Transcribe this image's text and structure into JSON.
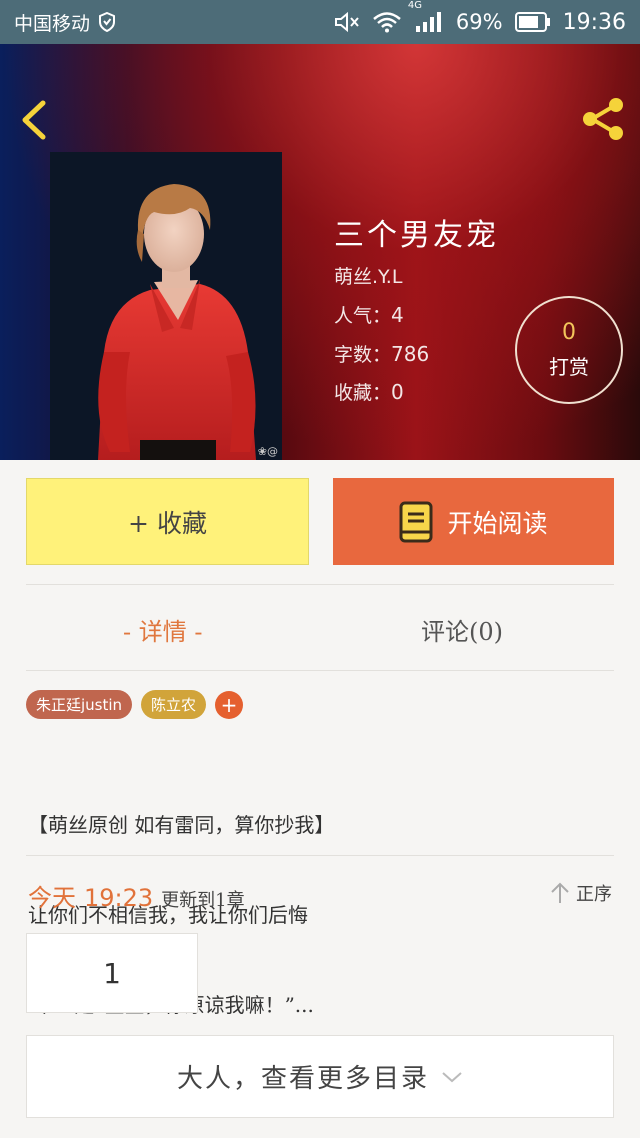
{
  "status_bar": {
    "carrier": "中国移动",
    "network": "4G",
    "battery": "69%",
    "time": "19:36"
  },
  "book": {
    "title": "三个男友宠",
    "author": "萌丝.Y.L",
    "popularity_label": "人气：",
    "popularity": "4",
    "words_label": "字数：",
    "words": "786",
    "favorites_label": "收藏：",
    "favorites": "0",
    "cover_watermark": "❀@"
  },
  "reward": {
    "count": "0",
    "label": "打赏"
  },
  "actions": {
    "favorite_label": "+ 收藏",
    "read_label": "开始阅读"
  },
  "tabs": {
    "detail": "- 详情 -",
    "comments": "评论(0)"
  },
  "tags": [
    "朱正廷justin",
    "陈立农"
  ],
  "tag_add": "+",
  "synopsis": {
    "line1": "【萌丝原创 如有雷同，算你抄我】",
    "line2": "让你们不相信我，我让你们后悔",
    "line3": " 朱正廷“宝宝，你原谅我嘛！”..."
  },
  "update": {
    "day": "今天",
    "time": "19:23",
    "text": "更新到1章"
  },
  "order_label": "正序",
  "chapter_number": "1",
  "more_catalog": "大人，查看更多目录",
  "colors": {
    "accent_orange": "#e8683e",
    "favorite_yellow": "#fff27a",
    "status_bar": "#4d6c78"
  }
}
